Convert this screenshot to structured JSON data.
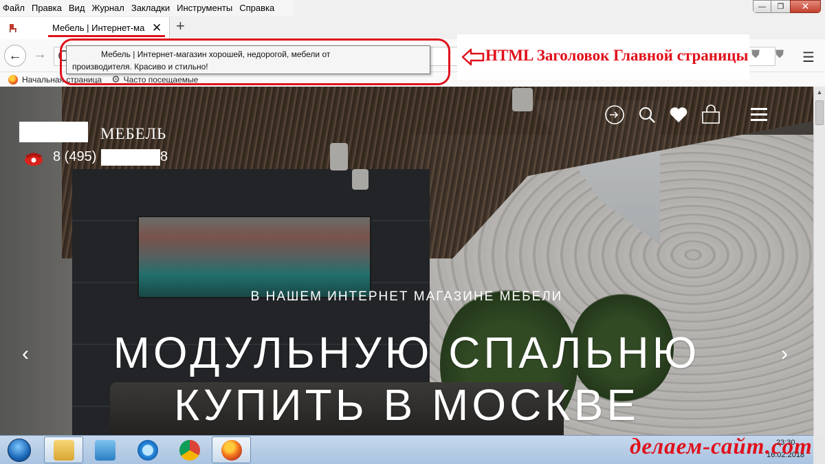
{
  "menubar": {
    "items": [
      "Файл",
      "Правка",
      "Вид",
      "Журнал",
      "Закладки",
      "Инструменты",
      "Справка"
    ]
  },
  "tab": {
    "title": "Мебель | Интернет-ма",
    "close_glyph": "✕",
    "new_tab_glyph": "+"
  },
  "tooltip": {
    "line1": "Мебель | Интернет-магазин хорошей, недорогой, мебели от",
    "line2": "производителя. Красиво и стильно!"
  },
  "annotation": {
    "text": "HTML Заголовок Главной страницы",
    "color": "#e0101a"
  },
  "bookmarks": {
    "items": [
      "Начальная страница",
      "Часто посещаемые"
    ]
  },
  "site": {
    "logo_text": "МЕБЕЛЬ",
    "phone_prefix": "8 (495)",
    "phone_suffix": "8",
    "subtitle": "В НАШЕМ ИНТЕРНЕТ МАГАЗИНЕ МЕБЕЛИ",
    "title_line1": "МОДУЛЬНУЮ СПАЛЬНЮ",
    "title_line2": "КУПИТЬ В МОСКВЕ",
    "icons": [
      "login-icon",
      "search-icon",
      "heart-icon",
      "cart-icon",
      "menu-icon"
    ]
  },
  "taskbar": {
    "time": "23:30",
    "date": "16.02.2018",
    "apps": [
      "explorer-icon",
      "media-player-icon",
      "internet-explorer-icon",
      "chrome-icon",
      "firefox-icon"
    ]
  },
  "watermark": "делаем-сайт.com",
  "window_controls": {
    "minimize": "—",
    "restore": "❐",
    "close": "✕"
  }
}
